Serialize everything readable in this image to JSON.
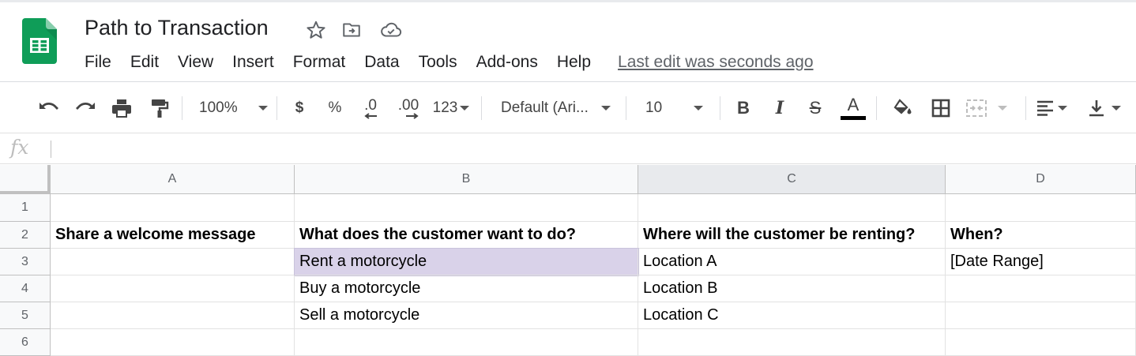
{
  "doc": {
    "title": "Path to Transaction"
  },
  "menu": {
    "items": [
      "File",
      "Edit",
      "View",
      "Insert",
      "Format",
      "Data",
      "Tools",
      "Add-ons",
      "Help"
    ],
    "last_edit": "Last edit was seconds ago"
  },
  "toolbar": {
    "zoom": "100%",
    "currency": "$",
    "percent": "%",
    "decrease_decimal": ".0",
    "increase_decimal": ".00",
    "more_formats": "123",
    "font": "Default (Ari...",
    "font_size": "10",
    "bold": "B",
    "italic": "I",
    "strikethrough": "S",
    "text_color": "A",
    "text_color_value": "#000000"
  },
  "formula_bar": {
    "fx_label": "fx",
    "value": ""
  },
  "sheet": {
    "columns": [
      "A",
      "B",
      "C",
      "D"
    ],
    "rows": [
      "1",
      "2",
      "3",
      "4",
      "5",
      "6"
    ],
    "cells": {
      "A2": "Share a welcome message",
      "B2": "What does the customer want to do?",
      "C2": "Where will the customer be renting?",
      "D2": "When?",
      "B3": "Rent a motorcycle",
      "C3": "Location A",
      "D3": "[Date Range]",
      "B4": "Buy a motorcycle",
      "C4": "Location B",
      "B5": "Sell a motorcycle",
      "C5": "Location C"
    },
    "selected_cell_color": "#d9d2e9"
  },
  "colors": {
    "sheets_green": "#0f9d58",
    "header_bg": "#f8f9fa"
  }
}
